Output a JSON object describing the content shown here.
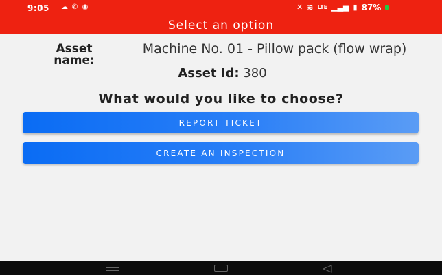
{
  "status_bar": {
    "time": "9:05",
    "battery": "87%",
    "icons": [
      "cloud-icon",
      "phone-icon",
      "whatsapp-icon",
      "mute-icon",
      "wifi-icon",
      "lte-icon",
      "signal-icon",
      "battery-icon"
    ]
  },
  "header": {
    "title": "Select an option",
    "background": "#ee2211"
  },
  "asset": {
    "name_label": "Asset name:",
    "name_value": "Machine No. 01 - Pillow pack (flow wrap)",
    "id_label": "Asset Id:",
    "id_value": "380"
  },
  "prompt": {
    "question": "What would you like to choose?"
  },
  "actions": {
    "report_label": "REPORT TICKET",
    "inspection_label": "CREATE AN INSPECTION",
    "accent": "#0a6cf4"
  },
  "nav_bar": {
    "buttons": [
      "menu-icon",
      "home-icon",
      "back-icon"
    ]
  }
}
